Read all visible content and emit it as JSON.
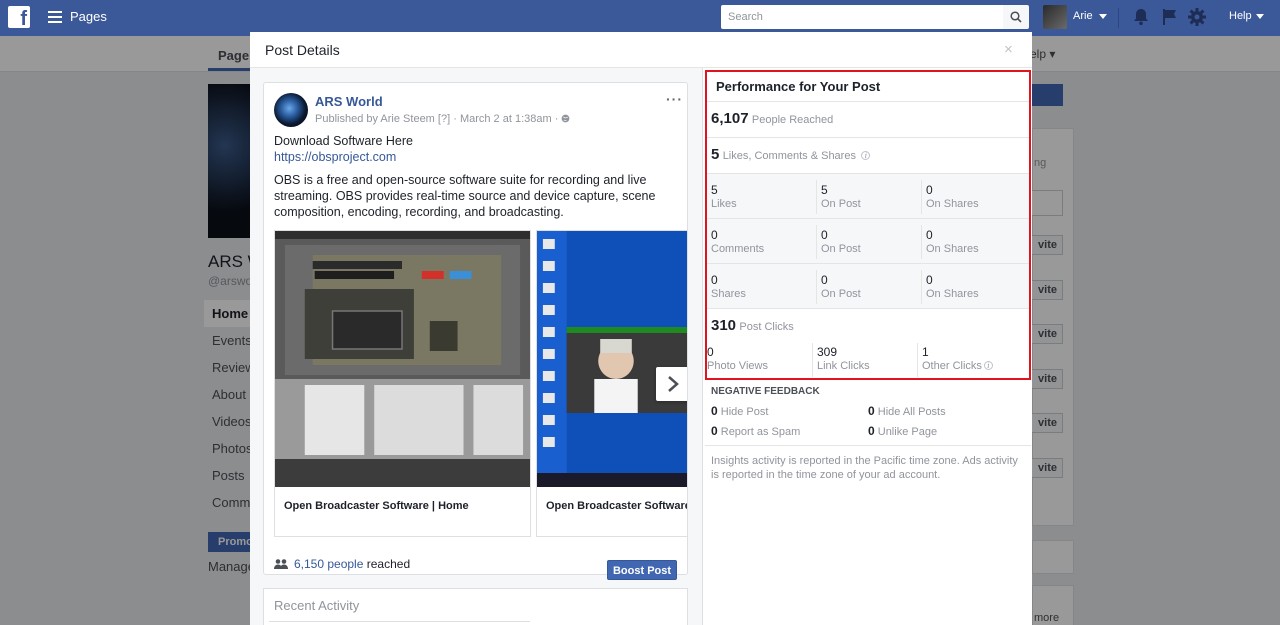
{
  "topbar": {
    "logo": "f",
    "section": "Pages",
    "search_placeholder": "Search",
    "user_name": "Arie",
    "help": "Help"
  },
  "background_page": {
    "tab": "Page",
    "help_tab": "elp",
    "page_name": "ARS W",
    "page_handle": "@arswo",
    "nav": [
      "Home",
      "Events",
      "Reviews",
      "About",
      "Videos",
      "Photos",
      "Posts",
      "Commu"
    ],
    "promote": "Promo",
    "manage": "Manage",
    "right_snippet": "ng",
    "invite": "vite",
    "more": "more"
  },
  "modal": {
    "title": "Post Details",
    "close": "×"
  },
  "post": {
    "author": "ARS World",
    "published_by": "Published by Arie Steem",
    "help_mark": "[?]",
    "date": "· March 2 at 1:38am ·",
    "line1": "Download Software Here",
    "link": "https://obsproject.com",
    "body": "OBS is a free and open-source software suite for recording and live streaming. OBS provides real-time source and device capture, scene composition, encoding, recording, and broadcasting.",
    "attachments": [
      {
        "caption": "Open Broadcaster Software | Home"
      },
      {
        "caption": "Open Broadcaster Software | Home"
      }
    ],
    "reach_link": "6,150 people",
    "reach_suffix": "reached",
    "reach_progress": 1.0,
    "boost": "Boost Post",
    "recent_activity": "Recent Activity"
  },
  "performance": {
    "title": "Performance for Your Post",
    "people_reached": {
      "value": "6,107",
      "label": "People Reached"
    },
    "engagement": {
      "value": "5",
      "label": "Likes, Comments & Shares"
    },
    "rows": [
      [
        {
          "n": "5",
          "l": "Likes"
        },
        {
          "n": "5",
          "l": "On Post"
        },
        {
          "n": "0",
          "l": "On Shares"
        }
      ],
      [
        {
          "n": "0",
          "l": "Comments"
        },
        {
          "n": "0",
          "l": "On Post"
        },
        {
          "n": "0",
          "l": "On Shares"
        }
      ],
      [
        {
          "n": "0",
          "l": "Shares"
        },
        {
          "n": "0",
          "l": "On Post"
        },
        {
          "n": "0",
          "l": "On Shares"
        }
      ]
    ],
    "post_clicks": {
      "value": "310",
      "label": "Post Clicks"
    },
    "clicks_row": [
      {
        "n": "0",
        "l": "Photo Views"
      },
      {
        "n": "309",
        "l": "Link Clicks"
      },
      {
        "n": "1",
        "l": "Other Clicks"
      }
    ],
    "negative_feedback": {
      "title": "NEGATIVE FEEDBACK",
      "items": [
        {
          "n": "0",
          "l": "Hide Post"
        },
        {
          "n": "0",
          "l": "Hide All Posts"
        },
        {
          "n": "0",
          "l": "Report as Spam"
        },
        {
          "n": "0",
          "l": "Unlike Page"
        }
      ]
    },
    "footnote": "Insights activity is reported in the Pacific time zone. Ads activity is reported in the time zone of your ad account."
  },
  "colors": {
    "brand": "#3b5998",
    "highlight": "#e0141e",
    "reach_bar": "#f7a20c",
    "link": "#365899"
  }
}
